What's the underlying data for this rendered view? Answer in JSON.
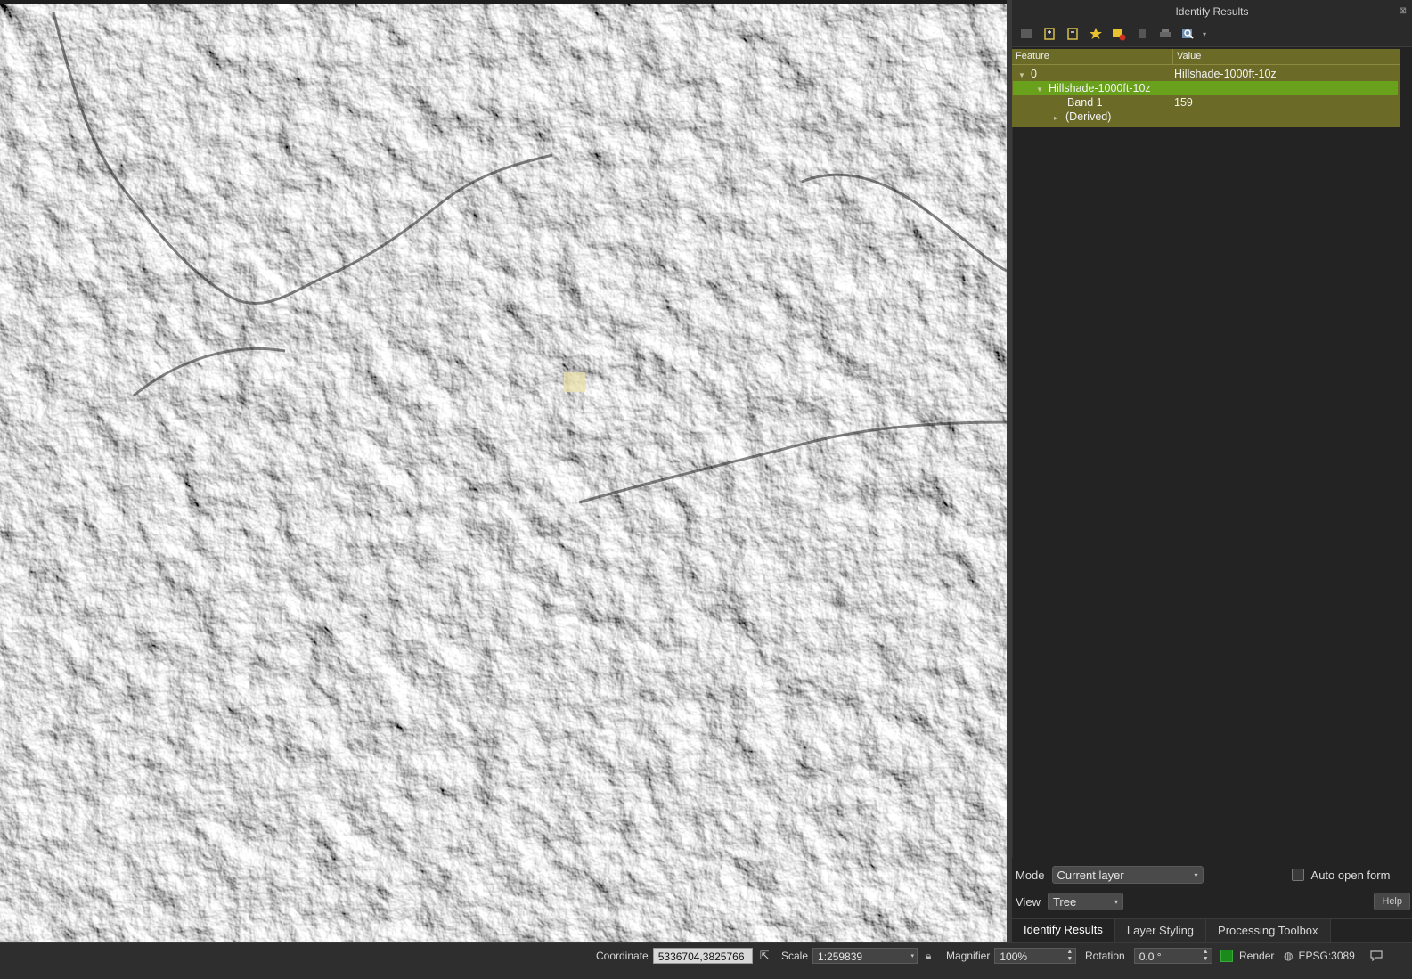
{
  "panel": {
    "title": "Identify Results",
    "toolbar_icons": [
      "expand-tree-icon",
      "expand-all-icon",
      "collapse-all-icon",
      "expand-new-icon",
      "clear-results-icon",
      "copy-feature-icon",
      "print-icon",
      "identify-settings-icon"
    ],
    "tree": {
      "col_feature": "Feature",
      "col_value": "Value",
      "rows": [
        {
          "feature": "0",
          "value": "Hillshade-1000ft-10z"
        },
        {
          "feature": "Hillshade-1000ft-10z",
          "value": ""
        },
        {
          "feature": "Band 1",
          "value": "159"
        },
        {
          "feature": "(Derived)",
          "value": ""
        }
      ]
    },
    "mode_label": "Mode",
    "mode_value": "Current layer",
    "auto_open_label": "Auto open form",
    "view_label": "View",
    "view_value": "Tree",
    "help_label": "Help",
    "tabs": [
      "Identify Results",
      "Layer Styling",
      "Processing Toolbox"
    ]
  },
  "status": {
    "coordinate_label": "Coordinate",
    "coordinate_value": "5336704,3825766",
    "scale_label": "Scale",
    "scale_value": "1:259839",
    "magnifier_label": "Magnifier",
    "magnifier_value": "100%",
    "rotation_label": "Rotation",
    "rotation_value": "0.0 °",
    "render_label": "Render",
    "crs_label": "EPSG:3089"
  },
  "colors": {
    "selected_row": "#6aa11c",
    "tree_bg": "#6b6a26",
    "render_checked": "#1a8a1a"
  }
}
